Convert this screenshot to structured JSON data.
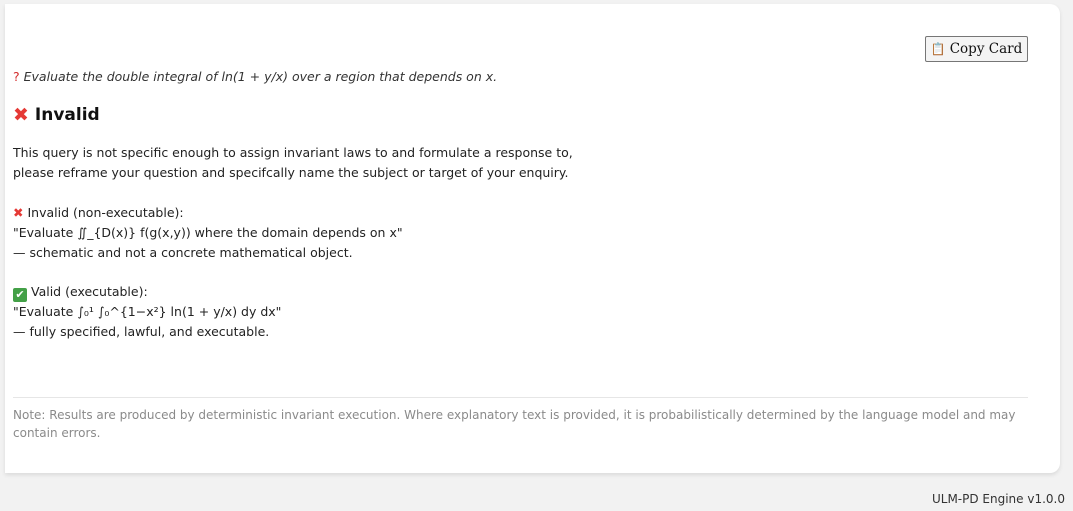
{
  "card": {
    "copy_button": {
      "icon": "clipboard-icon",
      "label": "Copy Card"
    },
    "question": {
      "icon": "question-mark-icon",
      "text": "Evaluate the double integral of ln(1 + y/x) over a region that depends on x."
    },
    "status": {
      "icon": "cross-mark-icon",
      "label": "Invalid"
    },
    "message_lines": [
      "This query is not specific enough to assign invariant laws to and formulate a response to,",
      "please reframe your question and specifcally name the subject or target of your enquiry."
    ],
    "invalid_example": {
      "icon": "cross-mark-icon",
      "heading": "Invalid (non-executable):",
      "query": "\"Evaluate ∬_{D(x)} f(g(x,y)) where the domain depends on x\"",
      "comment": "— schematic and not a concrete mathematical object."
    },
    "valid_example": {
      "icon": "check-mark-icon",
      "heading": "Valid (executable):",
      "query": "\"Evaluate ∫₀¹ ∫₀^{1−x²} ln(1 + y/x) dy dx\"",
      "comment": "— fully specified, lawful, and executable."
    },
    "note": "Note: Results are produced by deterministic invariant execution. Where explanatory text is provided, it is probabilistically determined by the language model and may contain errors."
  },
  "footer": {
    "version": "ULM-PD Engine v1.0.0"
  },
  "colors": {
    "error": "#e53935",
    "success": "#43a047",
    "note_text": "#8a8a8a",
    "background": "#f2f2f2",
    "card": "#ffffff"
  }
}
